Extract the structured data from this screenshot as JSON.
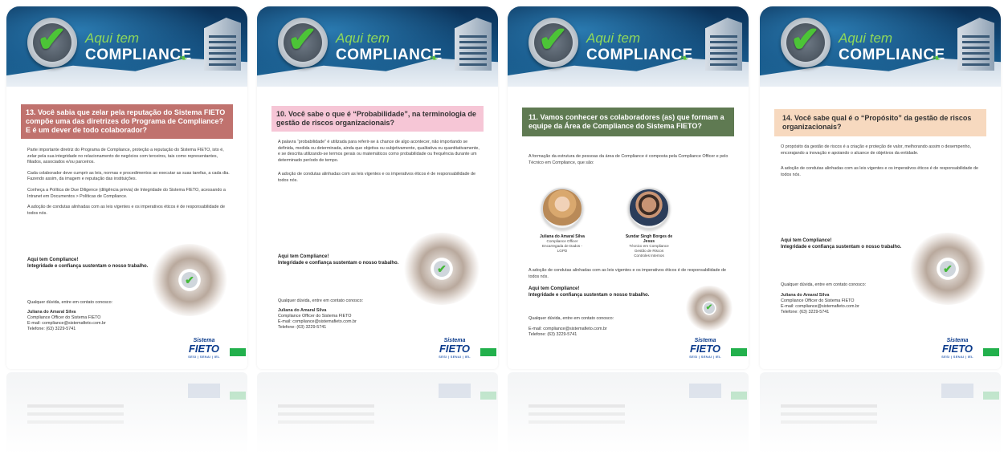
{
  "banner": {
    "aqui": "Aqui tem",
    "compliance": "COMPLIANCE"
  },
  "brand": {
    "line1": "Sistema",
    "line2": "FIETO",
    "line3": "SESI | SENAI | IEL"
  },
  "cards": [
    {
      "question": "13. Você sabia que zelar pela reputação do Sistema FIETO compõe uma das diretrizes do Programa de Compliance? E é um dever de todo colaborador?",
      "header_color": "#c0726e",
      "paragraphs": [
        "Parte importante diretriz do Programa de Compliance, proteção a reputação do Sistema FIETO, isto é, zelar pela sua integridade no relacionamento de negócios com terceiros, tais como representantes, filiados, associados e/ou parceiros.",
        "Cada colaborador deve cumprir as leis, normas e procedimentos ao executar as suas tarefas, a cada dia. Fazendo assim, da imagem e reputação das instituições.",
        "Conheça a Política de Due Diligence (diligência prévia) de Integridade do Sistema FIETO, acessando a Intranet em Documentos > Políticas de Compliance.",
        "A adoção de condutas alinhadas com as leis vigentes e os imperativos éticos é de responsabilidade de todos nós."
      ],
      "slogan1": "Aqui tem Compliance!",
      "slogan2": "Integridade e confiança sustentam o nosso trabalho.",
      "contact_intro": "Qualquer dúvida, entre em contato conosco:",
      "contact_name": "Juliana do Amaral Silva",
      "contact_role": "Compliance Officer do Sistema FIETO",
      "contact_email": "E-mail: compliance@sistemafieto.com.br",
      "contact_phone": "Telefone: (63) 3229-5741"
    },
    {
      "question": "10. Você sabe o que é “Probabilidade”, na terminologia de gestão de riscos organizacionais?",
      "header_color": "#f6c6d6",
      "paragraphs": [
        "A palavra “probabilidade” é utilizada para referir-se à chance de algo acontecer, não importando se definida, medida ou determinada, ainda que objetiva ou subjetivamente, qualitativa ou quantitativamente, e se descrita utilizando-se termos gerais ou matemáticos como probabilidade ou frequência durante um determinado período de tempo.",
        "A adoção de condutas alinhadas com as leis vigentes e os imperativos éticos é de responsabilidade de todos nós."
      ],
      "slogan1": "Aqui tem Compliance!",
      "slogan2": "Integridade e confiança sustentam o nosso trabalho.",
      "contact_intro": "Qualquer dúvida, entre em contato conosco:",
      "contact_name": "Juliana do Amaral Silva",
      "contact_role": "Compliance Officer do Sistema FIETO",
      "contact_email": "E-mail: compliance@sistemafieto.com.br",
      "contact_phone": "Telefone: (63) 3229-5741"
    },
    {
      "question": "11. Vamos conhecer os colaboradores (as) que formam a equipe da Área de Compliance do Sistema FIETO?",
      "header_color": "#5f7a52",
      "paragraphs": [
        "A formação da estrutura de pessoas da área de Compliance é composta pela Compliance Officer e pelo Técnico em Compliance, que são:"
      ],
      "people": [
        {
          "name": "Juliana do Amaral Silva",
          "role": "Compliance Officer\nEncarregada de Dados - LGPD"
        },
        {
          "name": "Sundar Singh Borges de Jesus",
          "role": "Técnico em Compliance\nGestão de Riscos\nControles Internos"
        }
      ],
      "after": "A adoção de condutas alinhadas com as leis vigentes e os imperativos éticos é de responsabilidade de todos nós.",
      "slogan1": "Aqui tem Compliance!",
      "slogan2": "Integridade e confiança sustentam o nosso trabalho.",
      "contact_intro": "Qualquer dúvida, entre em contato conosco:",
      "contact_email": "E-mail: compliance@sistemafieto.com.br",
      "contact_phone": "Telefone: (63) 3229-5741"
    },
    {
      "question": "14. Você sabe qual é o “Propósito” da gestão de riscos organizacionais?",
      "header_color": "#f7d9bf",
      "paragraphs": [
        "O propósito da gestão de riscos é a criação e proteção de valor, melhorando assim o desempenho, encorajando a inovação e apoiando o alcance de objetivos da entidade.",
        "A adoção de condutas alinhadas com as leis vigentes e os imperativos éticos é de responsabilidade de todos nós."
      ],
      "slogan1": "Aqui tem Compliance!",
      "slogan2": "Integridade e confiança sustentam o nosso trabalho.",
      "contact_intro": "Qualquer dúvida, entre em contato conosco:",
      "contact_name": "Juliana do Amaral Silva",
      "contact_role": "Compliance Officer do Sistema FIETO",
      "contact_email": "E-mail: compliance@sistemafieto.com.br",
      "contact_phone": "Telefone: (63) 3229-5741"
    }
  ]
}
